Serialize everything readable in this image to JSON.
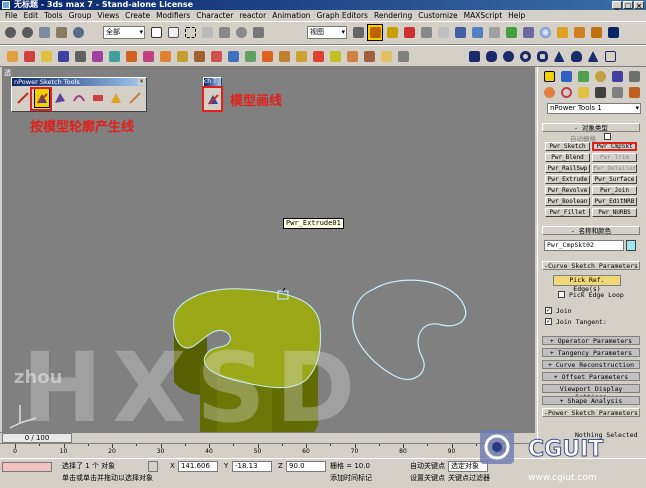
{
  "app": {
    "title": "无标题 - 3ds max 7 - Stand-alone License"
  },
  "menu": [
    "File",
    "Edit",
    "Tools",
    "Group",
    "Views",
    "Create",
    "Modifiers",
    "Character",
    "reactor",
    "Animation",
    "Graph Editors",
    "Rendering",
    "Customize",
    "MAXScript",
    "Help"
  ],
  "toolbar": {
    "selection_filter": "全部",
    "coord_system": "视图"
  },
  "viewport": {
    "label": "透",
    "tooltip": "Pwr_Extrude01"
  },
  "npower_panel": {
    "title": "nPower Sketch Tools",
    "small_title": "ch T"
  },
  "annotations": {
    "outline_label": "按模型轮廓产生线",
    "draw_label": "模型画线"
  },
  "watermarks": {
    "main": "HXSD",
    "sub": "zhou"
  },
  "command_panel": {
    "dropdown": "nPower Tools 1",
    "object_type_header": "对象类型",
    "autogrid_label": "自动栅格",
    "buttons": [
      "Pwr_Sketch",
      "Pwr_CmpSkt",
      "Pwr_Blend",
      "Pwr_Trim",
      "Pwr_RailSwp",
      "Pwr_Detailer",
      "Pwr_Extrude",
      "Pwr_Surface",
      "Pwr_Revolve",
      "Pwr_Join",
      "Pwr_Boolean",
      "Pwr_EditNRB",
      "Pwr_Fillet",
      "Pwr_NURBS"
    ],
    "active_button": "Pwr_CmpSkt",
    "name_color_header": "名称和颜色",
    "object_name": "Pwr_CmpSkt02",
    "curve_sketch_header": "-Curve Sketch Parameters",
    "pick_ref_edge": "Pick Ref. Edge(s)",
    "pick_edge_loop": "Pick Edge Loop",
    "join_label": "Join",
    "join_tangent_label": "Join Tangent:",
    "rollouts": [
      "Operator Parameters",
      "Tangency Parameters",
      "Curve Reconstruction",
      "Offset Parameters",
      "Viewport Display Settings",
      "Shape Analysis",
      "-Power Sketch Parameters"
    ]
  },
  "timeline": {
    "position": "0 / 100",
    "ticks": [
      "0",
      "10",
      "20",
      "30",
      "40",
      "50",
      "60",
      "70",
      "80",
      "90",
      "100"
    ]
  },
  "status": {
    "selected": "选择了 1 个 对象",
    "prompt": "单击或单击并拖动以选择对象",
    "x_label": "X",
    "x_value": "141.606",
    "y_label": "Y",
    "y_value": "-18.13",
    "z_label": "Z",
    "z_value": "90.0",
    "grid_label": "栅格 = 10.0",
    "add_time_tag": "添加时间标记",
    "auto_key": "自动关键点",
    "set_key": "设置关键点",
    "selected_objects": "选定对象",
    "key_filters": "关键点过滤器",
    "nothing_selected": "Nothing Selected"
  },
  "logo": {
    "text": "CGUIT",
    "url": "www.cgiut.com"
  },
  "colors": {
    "viewport_bg": "#808080",
    "object_green": "#9aa817",
    "spline_cyan": "#c8f0ff",
    "annotation_red": "#e0211b"
  }
}
